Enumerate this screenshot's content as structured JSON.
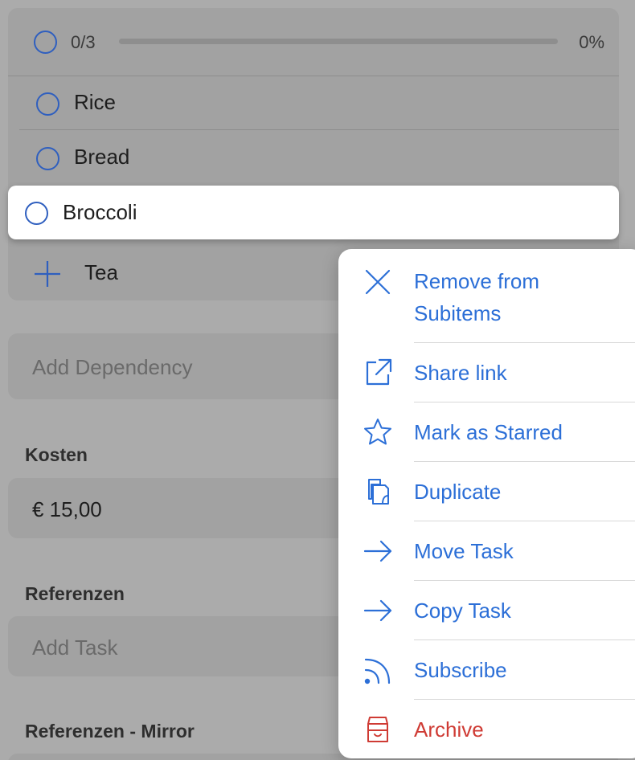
{
  "subitems": {
    "progress": {
      "count": "0/3",
      "percent": "0%",
      "fraction": 0
    },
    "items": [
      {
        "label": "Rice"
      },
      {
        "label": "Bread"
      },
      {
        "label": "Broccoli"
      }
    ],
    "add_item_label": "Tea"
  },
  "dependency": {
    "placeholder": "Add Dependency"
  },
  "kosten": {
    "label": "Kosten",
    "value": "€ 15,00"
  },
  "referenzen": {
    "label": "Referenzen",
    "placeholder": "Add Task"
  },
  "referenzen_mirror": {
    "label": "Referenzen - Mirror"
  },
  "context_menu": {
    "items": [
      {
        "icon": "close-icon",
        "label_line1": "Remove from",
        "label_line2": "Subitems"
      },
      {
        "icon": "share-external-icon",
        "label": "Share link"
      },
      {
        "icon": "star-icon",
        "label": "Mark as Starred"
      },
      {
        "icon": "duplicate-icon",
        "label": "Duplicate"
      },
      {
        "icon": "arrow-right-icon",
        "label": "Move Task"
      },
      {
        "icon": "arrow-right-icon",
        "label": "Copy Task"
      },
      {
        "icon": "rss-icon",
        "label": "Subscribe"
      },
      {
        "icon": "archive-box-icon",
        "label": "Archive"
      }
    ]
  },
  "colors": {
    "accent": "#2c6fd7",
    "danger": "#cf3b34",
    "dim_background": "#ababab"
  }
}
